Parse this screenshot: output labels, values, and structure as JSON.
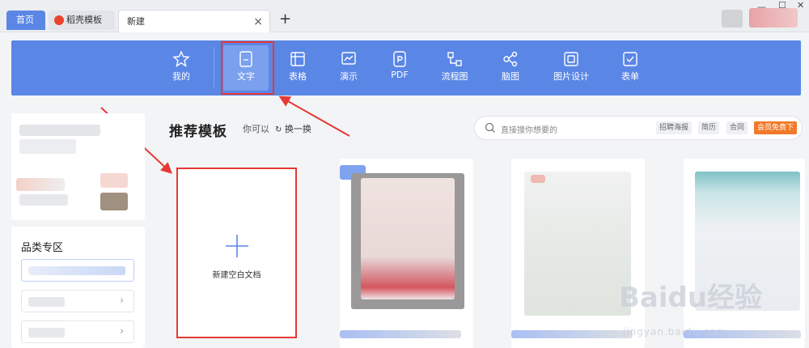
{
  "tabs": {
    "home": "首页",
    "daoke": "稻壳模板",
    "new": "新建",
    "close": "×",
    "add": "+"
  },
  "toolbar": {
    "items": [
      {
        "label": "我的",
        "icon": "star-icon"
      },
      {
        "label": "文字",
        "icon": "document-icon",
        "active": true
      },
      {
        "label": "表格",
        "icon": "table-icon"
      },
      {
        "label": "演示",
        "icon": "presentation-icon"
      },
      {
        "label": "PDF",
        "icon": "pdf-icon"
      },
      {
        "label": "流程图",
        "icon": "flowchart-icon"
      },
      {
        "label": "脑图",
        "icon": "mindmap-icon"
      },
      {
        "label": "图片设计",
        "icon": "image-design-icon"
      },
      {
        "label": "表单",
        "icon": "form-icon"
      }
    ]
  },
  "sidebar": {
    "section_title": "品类专区"
  },
  "main": {
    "title": "推荐模板",
    "hint": "你可以",
    "swap": "换一换",
    "search_placeholder": "直接搜你想要的",
    "chips": [
      "招聘海报",
      "简历",
      "合同"
    ],
    "vip_chip": "会员免费下",
    "new_blank": "新建空白文档"
  },
  "watermark": {
    "brand": "Baidu经验",
    "url": "jingyan.baidu.com"
  },
  "colors": {
    "toolbar": "#5a86e6",
    "active_tab": "#5b86e5",
    "highlight": "#e53935",
    "vip": "#f07a2a"
  }
}
